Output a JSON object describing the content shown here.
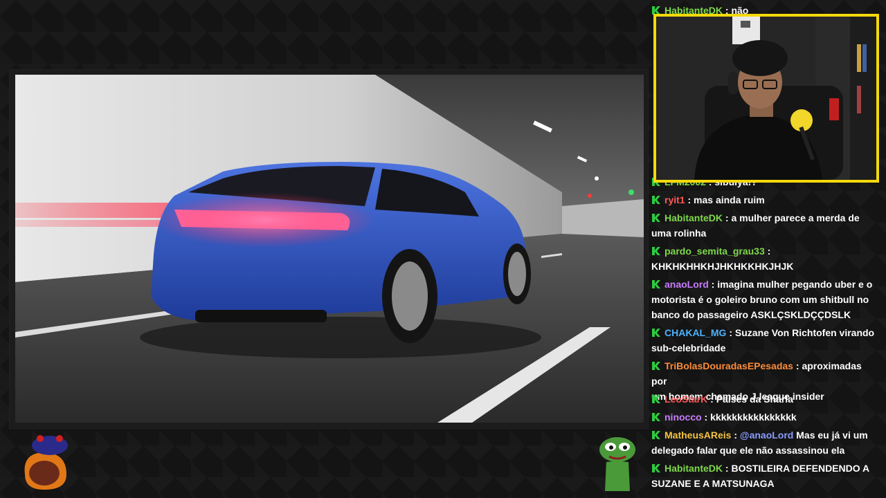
{
  "colors": {
    "badge_green": "#2ecc40",
    "webcam_border": "#f5d90a",
    "mention": "#8c9cff",
    "car_blue": "#2f59c7"
  },
  "icons": {
    "chat_badge": "k-badge-icon",
    "left_emote": "mascot-emote",
    "right_emote": "pepe-frog-emote"
  },
  "chat": {
    "messages": [
      {
        "user": "HabitanteDK",
        "color": "#7fd94b",
        "sep": " : ",
        "text": "não"
      },
      {
        "user": "LFM2002",
        "color": "#7fd94b",
        "sep": " : ",
        "text": "sibuiya!?"
      },
      {
        "user": "ryit1",
        "color": "#ff5a5a",
        "sep": " : ",
        "text": "mas ainda ruim"
      },
      {
        "user": "HabitanteDK",
        "color": "#7fd94b",
        "sep": " : ",
        "text": "a mulher parece a merda de",
        "text2": "uma rolinha"
      },
      {
        "user": "pardo_semita_grau33",
        "color": "#7fd94b",
        "sep": " :",
        "text": "",
        "text2": "KHKHKHHKHJHKHKKHKJHJK"
      },
      {
        "user": "anaoLord",
        "color": "#c77dff",
        "sep": " : ",
        "text": "imagina mulher pegando uber e o",
        "text2": "motorista é o goleiro bruno com um shitbull no",
        "text3": "banco do passageiro ASKLÇSKLDÇÇDSLK"
      },
      {
        "user": "CHAKAL_MG",
        "color": "#4db3ff",
        "sep": " : ",
        "text": "Suzane Von Richtofen virando",
        "text2": "sub-celebridade"
      },
      {
        "user": "TriBolasDouradasEPesadas",
        "color": "#ff8c3a",
        "sep": " : ",
        "text": "aproximadas por",
        "text2": "um homem chamado J league insider"
      },
      {
        "user": "LeoStarK",
        "color": "#ff5a5a",
        "sep": " : ",
        "text": "Países da Sharia"
      },
      {
        "user": "ninocco",
        "color": "#c77dff",
        "sep": " : ",
        "text": "kkkkkkkkkkkkkkkk"
      },
      {
        "user": "MatheusAReis",
        "color": "#f5c542",
        "sep": " : ",
        "mention": "@anaoLord",
        "text": " Mas eu já vi um",
        "text2": "delegado falar que ele não assassinou ela"
      },
      {
        "user": "HabitanteDK",
        "color": "#7fd94b",
        "sep": " : ",
        "text": "BOSTILEIRA DEFENDENDO A",
        "text2": "SUZANE E A MATSUNAGA"
      }
    ]
  }
}
